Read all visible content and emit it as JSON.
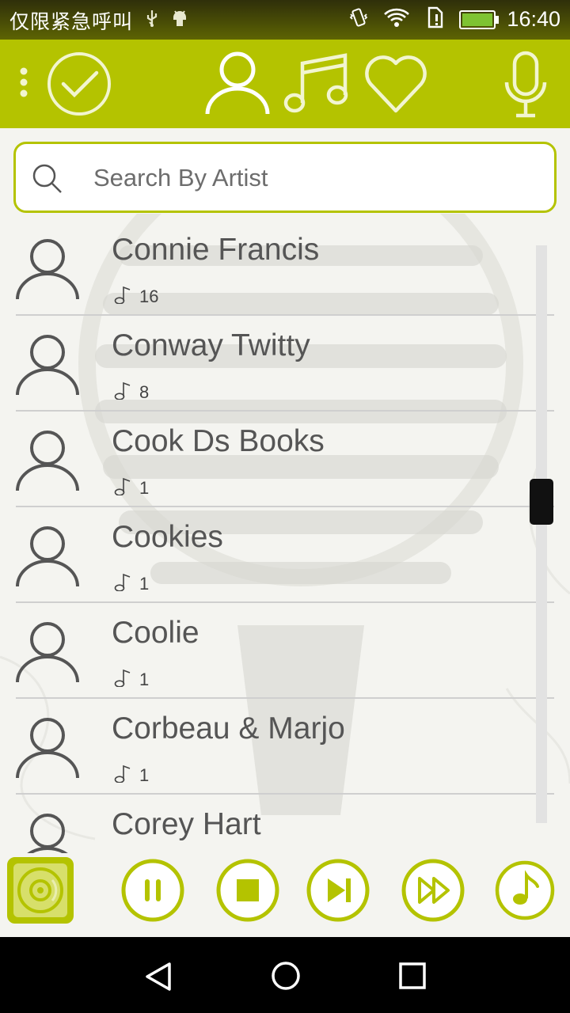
{
  "status_bar": {
    "carrier_text": "仅限紧急呼叫",
    "time": "16:40",
    "icons": [
      "usb-icon",
      "android-debug-icon",
      "vibrate-icon",
      "wifi-icon",
      "sim-alert-icon",
      "battery-charging-icon"
    ]
  },
  "toolbar": {
    "icons": [
      "overflow-menu-icon",
      "check-circle-icon",
      "artist-person-icon",
      "music-notes-icon",
      "heart-icon",
      "microphone-icon"
    ],
    "accent_color": "#b4c300"
  },
  "search": {
    "placeholder": "Search By Artist",
    "value": ""
  },
  "artists": [
    {
      "name": "Connie Francis",
      "count": "16"
    },
    {
      "name": "Conway Twitty",
      "count": "8"
    },
    {
      "name": "Cook Ds Books",
      "count": "1"
    },
    {
      "name": "Cookies",
      "count": "1"
    },
    {
      "name": "Coolie",
      "count": "1"
    },
    {
      "name": "Corbeau & Marjo",
      "count": "1"
    },
    {
      "name": "Corey Hart",
      "count": ""
    }
  ],
  "player": {
    "icons": [
      "disc-icon",
      "pause-icon",
      "stop-icon",
      "skip-next-icon",
      "fast-forward-icon",
      "now-playing-note-icon"
    ]
  },
  "nav_bar": {
    "icons": [
      "back-icon",
      "home-icon",
      "recents-icon"
    ]
  }
}
